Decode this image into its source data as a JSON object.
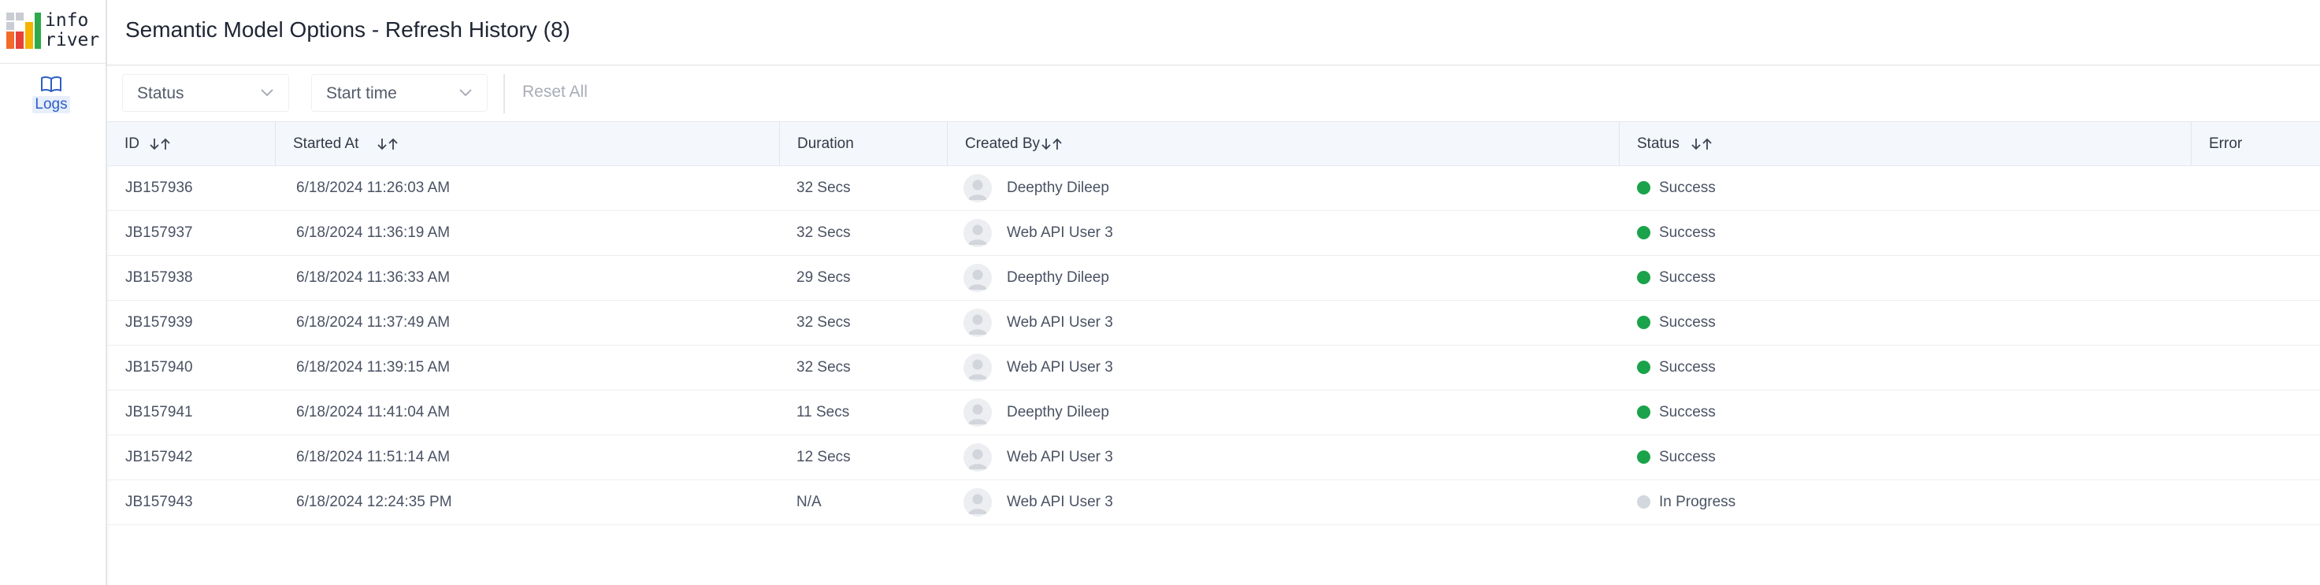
{
  "logo": {
    "line1": "info",
    "line2": "river"
  },
  "nav": {
    "items": [
      {
        "label": "Logs",
        "icon": "book-icon"
      }
    ]
  },
  "header": {
    "title": "Semantic Model Options - Refresh History (8)"
  },
  "filters": {
    "status_label": "Status",
    "start_time_label": "Start time",
    "reset_label": "Reset All"
  },
  "table": {
    "columns": {
      "id": "ID",
      "started_at": "Started At",
      "duration": "Duration",
      "created_by": "Created By",
      "status": "Status",
      "error": "Error"
    },
    "rows": [
      {
        "id": "JB157936",
        "started_at": "6/18/2024 11:26:03 AM",
        "duration": "32 Secs",
        "created_by": "Deepthy Dileep",
        "status": "Success",
        "error": ""
      },
      {
        "id": "JB157937",
        "started_at": "6/18/2024 11:36:19 AM",
        "duration": "32 Secs",
        "created_by": "Web API User 3",
        "status": "Success",
        "error": ""
      },
      {
        "id": "JB157938",
        "started_at": "6/18/2024 11:36:33 AM",
        "duration": "29 Secs",
        "created_by": "Deepthy Dileep",
        "status": "Success",
        "error": ""
      },
      {
        "id": "JB157939",
        "started_at": "6/18/2024 11:37:49 AM",
        "duration": "32 Secs",
        "created_by": "Web API User 3",
        "status": "Success",
        "error": ""
      },
      {
        "id": "JB157940",
        "started_at": "6/18/2024 11:39:15 AM",
        "duration": "32 Secs",
        "created_by": "Web API User 3",
        "status": "Success",
        "error": ""
      },
      {
        "id": "JB157941",
        "started_at": "6/18/2024 11:41:04 AM",
        "duration": "11 Secs",
        "created_by": "Deepthy Dileep",
        "status": "Success",
        "error": ""
      },
      {
        "id": "JB157942",
        "started_at": "6/18/2024 11:51:14 AM",
        "duration": "12 Secs",
        "created_by": "Web API User 3",
        "status": "Success",
        "error": ""
      },
      {
        "id": "JB157943",
        "started_at": "6/18/2024 12:24:35 PM",
        "duration": "N/A",
        "created_by": "Web API User 3",
        "status": "In Progress",
        "error": ""
      }
    ]
  },
  "colors": {
    "brand_orange": "#f26b2b",
    "brand_red": "#e8413a",
    "brand_yellow": "#f4b400",
    "brand_green": "#2eaa4a",
    "status_success": "#1aa34a",
    "status_in_progress": "#d3d7de",
    "nav_active": "#2f5fc4"
  }
}
